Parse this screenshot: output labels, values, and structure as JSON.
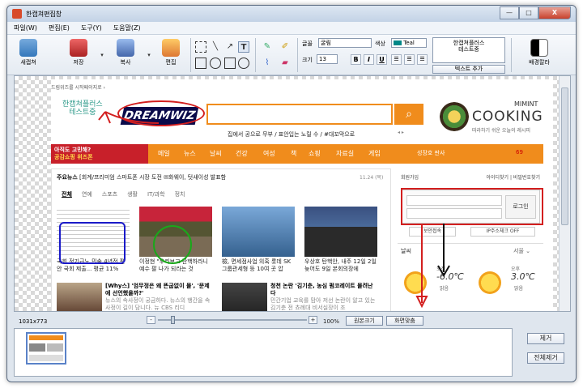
{
  "window": {
    "title": "한캡쳐편집창",
    "min_label": "—",
    "max_label": "□",
    "close_label": "X"
  },
  "menu": [
    "파일(W)",
    "편집(E)",
    "도구(Y)",
    "도움말(Z)"
  ],
  "toolbar": {
    "capture_label": "새캡쳐",
    "save_label": "저장",
    "copy_label": "복사",
    "edit_label": "편집",
    "font_label": "글꼴",
    "font_value": "굴림",
    "color_label": "색상",
    "color_value": "Teal",
    "size_label": "크기",
    "size_value": "13",
    "bold": "B",
    "italic": "I",
    "underline": "U",
    "text_content": "한캡쳐플러스\n테스트중",
    "add_text_label": "텍스트 추가",
    "bg_color_label": "배경칼라",
    "text_tool": "T"
  },
  "webpage": {
    "breadcrumb": "드림위즈를 시작페이지로 ›",
    "test_text": "한캡쳐플러스\n테스트중",
    "logo": "DREAMWIZ",
    "search_keywords": "집에서 공으로 무부 / 표안입는 노릴 수 / #대꼬막으로",
    "cooking_small": "MIMINT",
    "cooking_big": "COOKING",
    "cooking_sub": "따라하기 쉬운 오늘의 레시피",
    "promo_line1": "아직도 고민해?",
    "promo_line2": "공감쇼핑 위즈폰",
    "nav": [
      "메일",
      "뉴스",
      "날씨",
      "건강",
      "여성",
      "책",
      "쇼핑",
      "자료실",
      "게임"
    ],
    "nav_extra": "성장호 판사",
    "nav_temp": "69",
    "news_head": "주요뉴스",
    "news_headline": "[회계/프리미엄 스마트폰 시장 도전 ✉화웨이, 텃새이성 발표함",
    "news_date": "11.24 (목)",
    "tabs": [
      "전체",
      "연예",
      "스포츠",
      "생활",
      "IT/과학",
      "정치"
    ],
    "captions": [
      "국회,정기급노 민속 4년전 편안 국회 제출... 평균 11%",
      "이정현 \"우리보고 탄핵하라니 예수 팔 나가 되라는 것",
      "檢, 면세점사업 의혹 롯데 SK그룹관세형 등 10여 곳 압",
      "우상호 탄핵안, 내주 12일 2일 늦어도 9일 본회의장에"
    ],
    "row2": [
      {
        "title": "[Why스] '엄무정은 왜 뜬굽없이 몰', '문제에 선언했을까?'",
        "sub": "뉴스의 속사정이 궁금하다. 뉴스의 행간을 속 사정이 길이 담니다. 뉴 CBS 리디"
      },
      {
        "title": "청천 논란 '김기춘, 농심 펌코레이트 몰려난다",
        "sub": "민간기업 교육를 맘아 저선 논란이 알고 있는 김기춘 전 쵸례대 비서실장이 조"
      }
    ],
    "login_left": "회원가입",
    "login_right": "아이디찾기 | 비밀번호찾기",
    "login_btn": "로그인",
    "sub_left": "보안접속",
    "sub_right": "IP주소체크 OFF",
    "weather_label": "날씨",
    "weather_city": "서울 ⌄",
    "w1_label": "오전",
    "w1_temp": "-6.0℃",
    "w1_desc": "맑음",
    "w2_label": "오후",
    "w2_temp": "3.0℃",
    "w2_desc": "맑음"
  },
  "status": {
    "size": "1031x773",
    "zoom_minus": "-",
    "zoom_plus": "+",
    "zoom_pct": "100%",
    "original_label": "원본크기",
    "fit_label": "화면맞춤"
  },
  "side_buttons": {
    "remove": "제거",
    "remove_all": "전체제거"
  },
  "colors": {
    "orange": "#f08c1c",
    "red_annot": "#d31f1f",
    "green_annot": "#1aa81a",
    "blue_annot": "#1a1ac8"
  }
}
